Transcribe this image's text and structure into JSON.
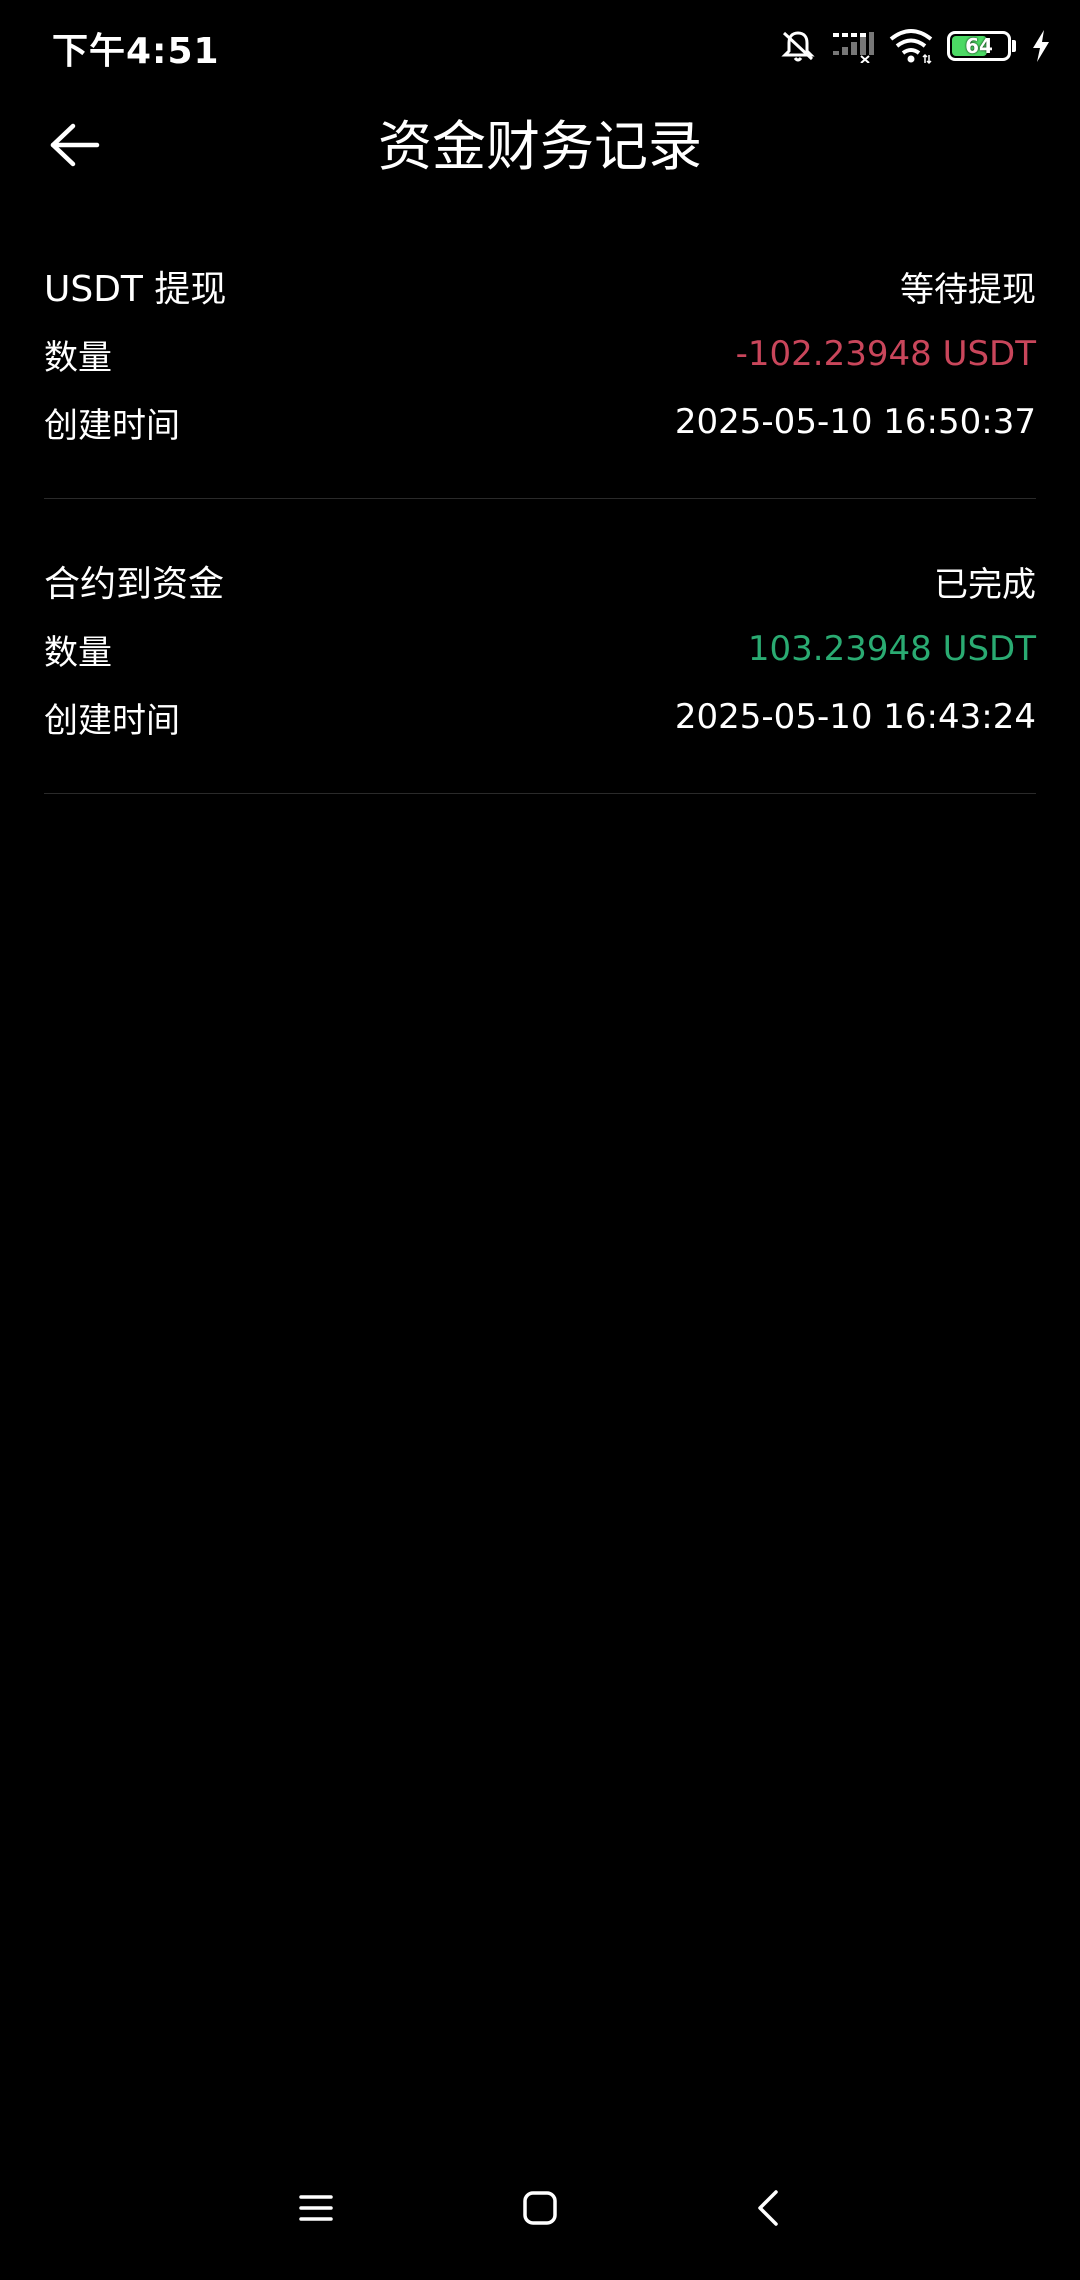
{
  "status_bar": {
    "time": "下午4:51",
    "battery_level": 64,
    "battery_text": "64",
    "icons": [
      "mute-bell-icon",
      "signal-icon",
      "wifi-icon",
      "battery-icon",
      "charging-bolt-icon"
    ]
  },
  "header": {
    "title": "资金财务记录",
    "back_icon": "arrow-left-icon"
  },
  "records": [
    {
      "type": "USDT 提现",
      "status": "等待提现",
      "amount_label": "数量",
      "amount": "-102.23948 USDT",
      "time_label": "创建时间",
      "time": "2025-05-10 16:50:37"
    },
    {
      "type": "合约到资金",
      "status": "已完成",
      "amount_label": "数量",
      "amount": "103.23948 USDT",
      "time_label": "创建时间",
      "time": "2025-05-10 16:43:24"
    }
  ],
  "colors": {
    "background": "#000000",
    "text": "#ffffff",
    "negative": "#c9465b",
    "positive": "#2aab72",
    "divider": "#2a2a2a",
    "battery": "#4cd964"
  },
  "nav_bar": {
    "icons": [
      "menu-icon",
      "home-icon",
      "back-icon"
    ]
  }
}
